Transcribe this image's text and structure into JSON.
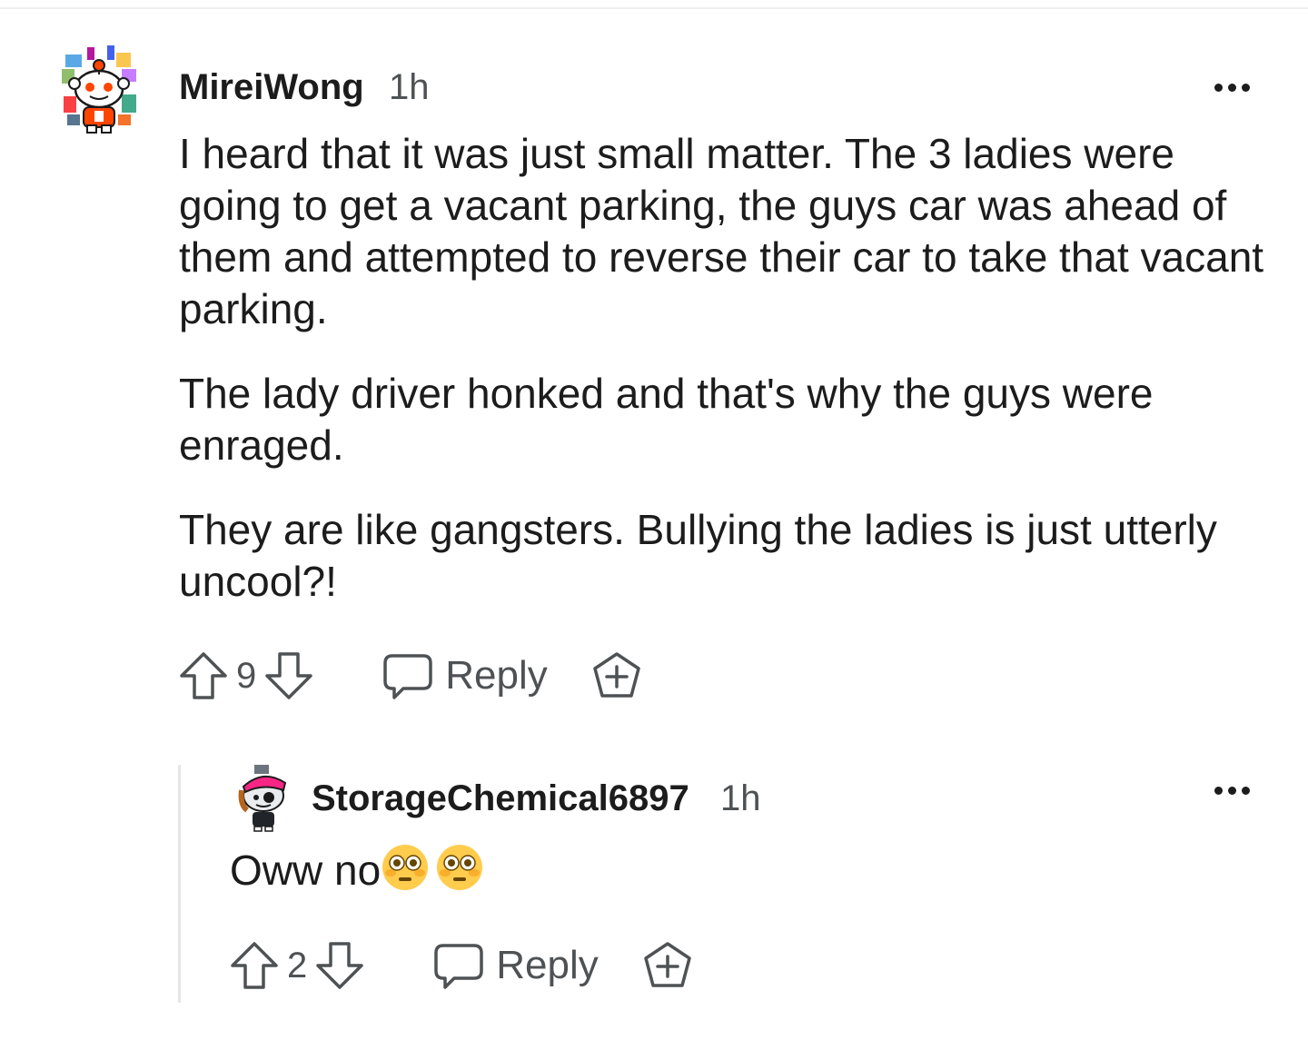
{
  "comments": [
    {
      "username": "MireiWong",
      "timestamp": "1h",
      "avatar_icon": "snoo-avatar-icon",
      "paragraphs": [
        "I heard that it was just small matter. The 3 ladies were going to get a vacant parking, the guys car was ahead of them and attempted to reverse their car to take that vacant parking.",
        "The lady driver honked and that's why the guys were enraged.",
        "They are like gangsters. Bullying the ladies is just utterly uncool?!"
      ],
      "score": "9",
      "reply_label": "Reply"
    },
    {
      "username": "StorageChemical6897",
      "timestamp": "1h",
      "avatar_icon": "snoo-avatar-icon",
      "text": "Oww no",
      "emojis": [
        "flushed-face-emoji",
        "flushed-face-emoji"
      ],
      "score": "2",
      "reply_label": "Reply"
    }
  ]
}
